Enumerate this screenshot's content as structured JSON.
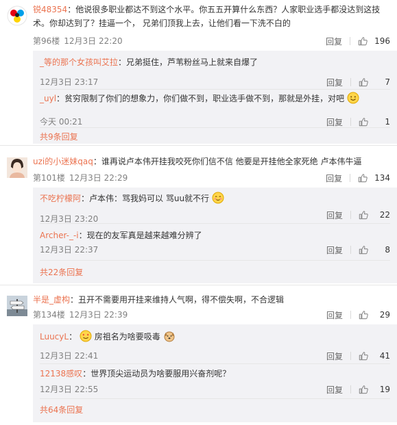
{
  "threads": [
    {
      "author": "锐48354",
      "text_line1": "他说很多职业都达不到这个水平。你五五开算什么东西？人家职业选手都没达到这技",
      "text_line2": "术。你却达到了？挂逼一个，           兄弟们顶我上去，让他们看一下洗不白的",
      "floor": "第96楼",
      "time": "12月3日 22:20",
      "reply_label": "回复",
      "likes": "196",
      "replies": [
        {
          "author": "_等的那个女孩叫艾拉",
          "text": "兄弟挺住，芦苇粉丝马上就来自爆了",
          "time": "12月3日 23:17",
          "reply_label": "回复",
          "likes": "7"
        },
        {
          "author": "_uyl",
          "text": "贫穷限制了你们的想象力，你们做不到，职业选手做不到，那就是外挂，对吧",
          "time": "今天 00:21",
          "reply_label": "回复",
          "likes": "1"
        }
      ],
      "more_label": "共9条回复"
    },
    {
      "author": "uzi的小迷妹qaq",
      "text_line1": "谁再说卢本伟开挂我咬死你们信不信 他要是开挂他全家死绝 卢本伟牛逼",
      "floor": "第101楼",
      "time": "12月3日 22:29",
      "reply_label": "回复",
      "likes": "134",
      "replies": [
        {
          "author": "不吃柠檬阿",
          "text": "卢本伟：骂我妈可以 骂uu就不行",
          "time": "12月3日 23:20",
          "reply_label": "回复",
          "likes": "22"
        },
        {
          "author": "Archer-_-i",
          "text": "现在的友军真是越来越难分辨了",
          "time": "12月3日 22:37",
          "reply_label": "回复",
          "likes": "8"
        }
      ],
      "more_label": "共22条回复"
    },
    {
      "author": "半是_虚构",
      "text_line1": "丑开不需要用开挂来维持人气啊，得不偿失啊，不合逻辑",
      "floor": "第134楼",
      "time": "12月3日 22:39",
      "reply_label": "回复",
      "likes": "29",
      "replies": [
        {
          "author": "LuucyL",
          "text": "房祖名为啥要吸毒",
          "time": "12月3日 22:41",
          "reply_label": "回复",
          "likes": "41"
        },
        {
          "author": "12138感叹",
          "text": "世界顶尖运动员为啥要服用兴奋剂呢？",
          "time": "12月3日 22:55",
          "reply_label": "回复",
          "likes": "19"
        }
      ],
      "more_label": "共64条回复"
    }
  ],
  "colors": {
    "name": "#eb7350",
    "meta": "#808080",
    "subBg": "#f2f2f5"
  }
}
